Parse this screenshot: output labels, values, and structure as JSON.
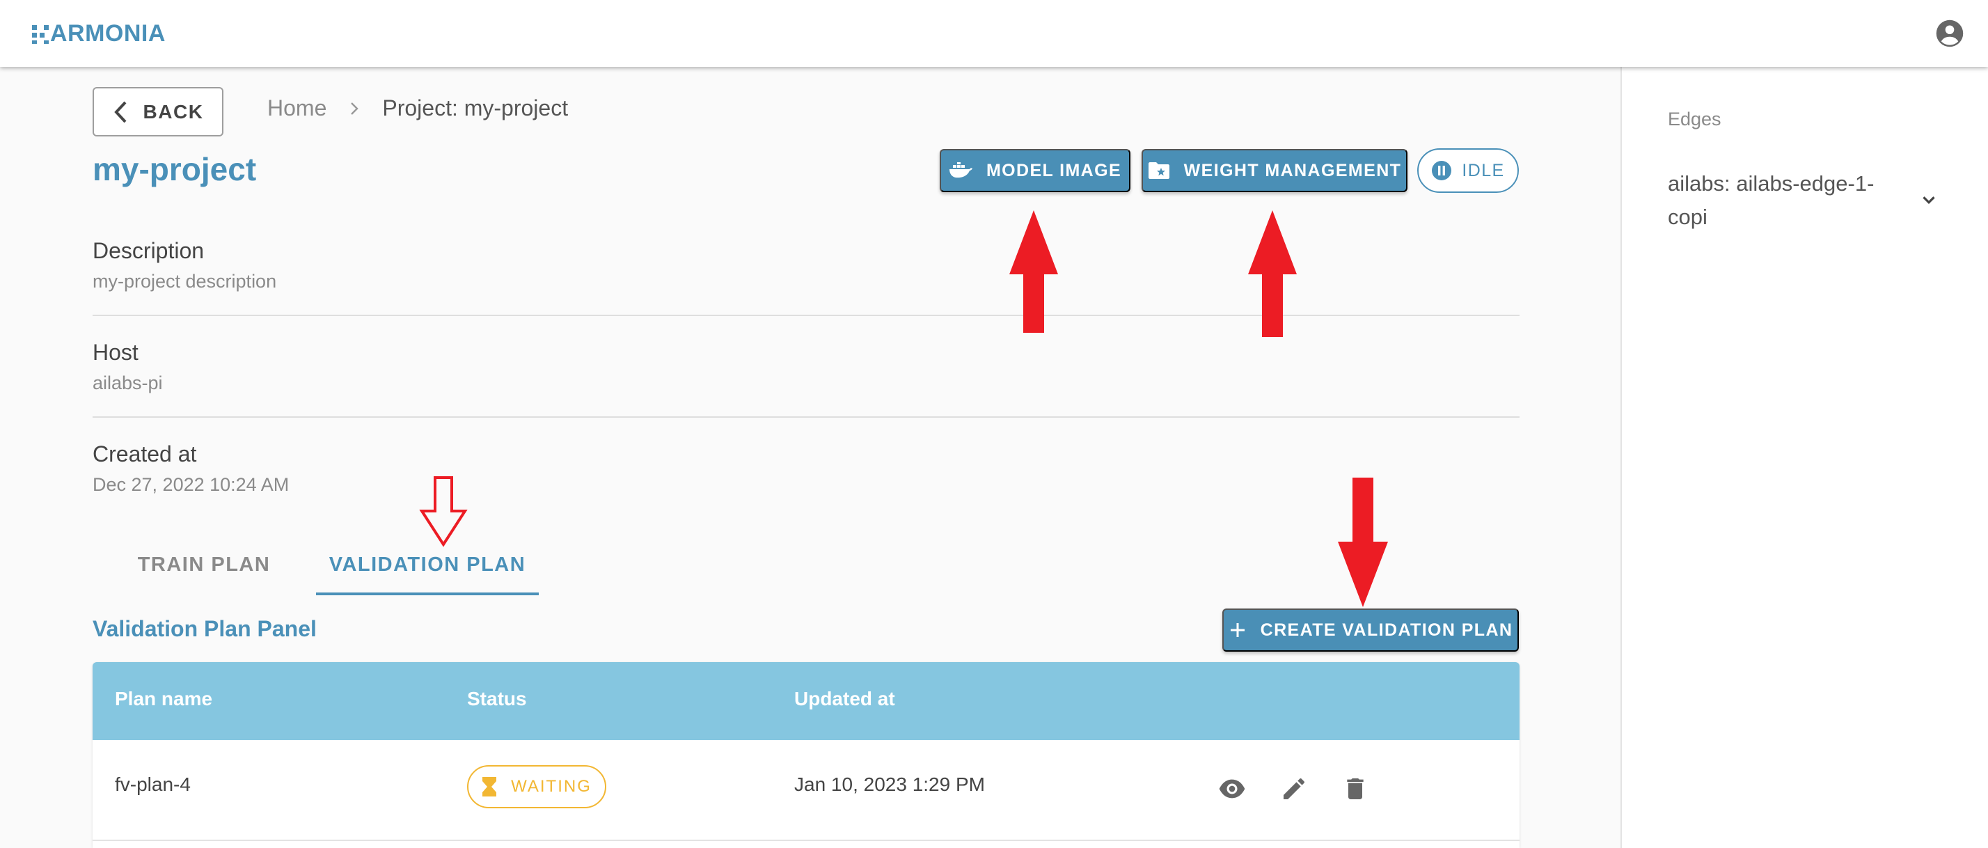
{
  "app": {
    "logo_text": "ARMONIA",
    "brand_color": "#4a90b8"
  },
  "appbar": {
    "account_icon": "account-circle-icon"
  },
  "header": {
    "back_label": "BACK",
    "breadcrumb": {
      "home": "Home",
      "current": "Project: my-project"
    },
    "title": "my-project",
    "model_image_label": "MODEL IMAGE",
    "weight_management_label": "WEIGHT MANAGEMENT",
    "status_label": "IDLE"
  },
  "details": {
    "description": {
      "label": "Description",
      "value": "my-project description"
    },
    "host": {
      "label": "Host",
      "value": "ailabs-pi"
    },
    "created_at": {
      "label": "Created at",
      "value": "Dec 27, 2022 10:24 AM"
    }
  },
  "tabs": [
    {
      "label": "TRAIN PLAN",
      "active": false
    },
    {
      "label": "VALIDATION PLAN",
      "active": true
    }
  ],
  "panel": {
    "title": "Validation Plan Panel",
    "create_label": "CREATE VALIDATION PLAN",
    "columns": [
      "Plan name",
      "Status",
      "Updated at"
    ],
    "rows": [
      {
        "plan_name": "fv-plan-4",
        "status": "WAITING",
        "updated_at": "Jan 10, 2023 1:29 PM"
      }
    ]
  },
  "sidebar": {
    "title": "Edges",
    "edge_label": "ailabs: ailabs-edge-1-copi"
  },
  "colors": {
    "primary": "#4a90b8",
    "table_header": "#85c6e0",
    "waiting": "#f2b733",
    "annotation_arrow": "#ec1c24"
  }
}
